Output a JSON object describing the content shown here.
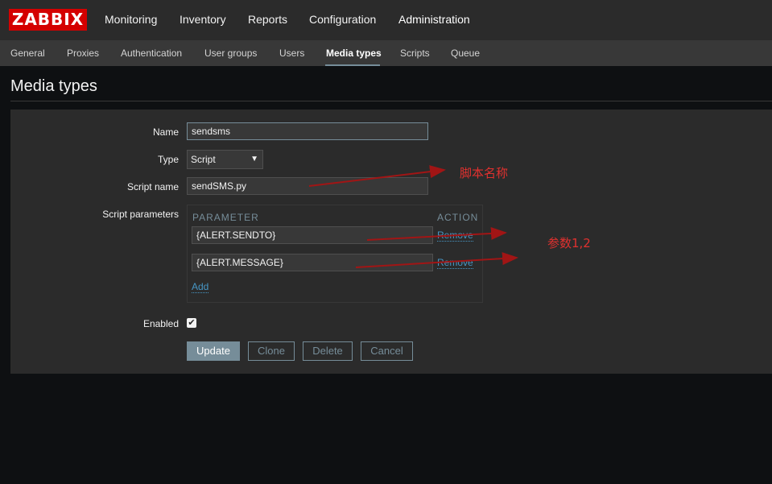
{
  "header": {
    "logo": "ZABBIX",
    "menu": [
      "Monitoring",
      "Inventory",
      "Reports",
      "Configuration",
      "Administration"
    ],
    "active_menu": "Administration"
  },
  "subnav": {
    "items": [
      "General",
      "Proxies",
      "Authentication",
      "User groups",
      "Users",
      "Media types",
      "Scripts",
      "Queue"
    ],
    "active": "Media types"
  },
  "page": {
    "title": "Media types"
  },
  "form": {
    "name_label": "Name",
    "name_value": "sendsms",
    "type_label": "Type",
    "type_value": "Script",
    "script_name_label": "Script name",
    "script_name_value": "sendSMS.py",
    "script_params_label": "Script parameters",
    "params_header": {
      "parameter": "PARAMETER",
      "action": "ACTION"
    },
    "params": [
      {
        "value": "{ALERT.SENDTO}",
        "action": "Remove"
      },
      {
        "value": "{ALERT.MESSAGE}",
        "action": "Remove"
      }
    ],
    "add_label": "Add",
    "enabled_label": "Enabled",
    "enabled_checked": true
  },
  "buttons": {
    "update": "Update",
    "clone": "Clone",
    "delete": "Delete",
    "cancel": "Cancel"
  },
  "annotations": {
    "script_name_note": "脚本名称",
    "params_note": "参数1,2",
    "color": "#e0312f"
  },
  "colors": {
    "brand": "#d40000",
    "accent": "#768d99",
    "link": "#4796c4"
  }
}
